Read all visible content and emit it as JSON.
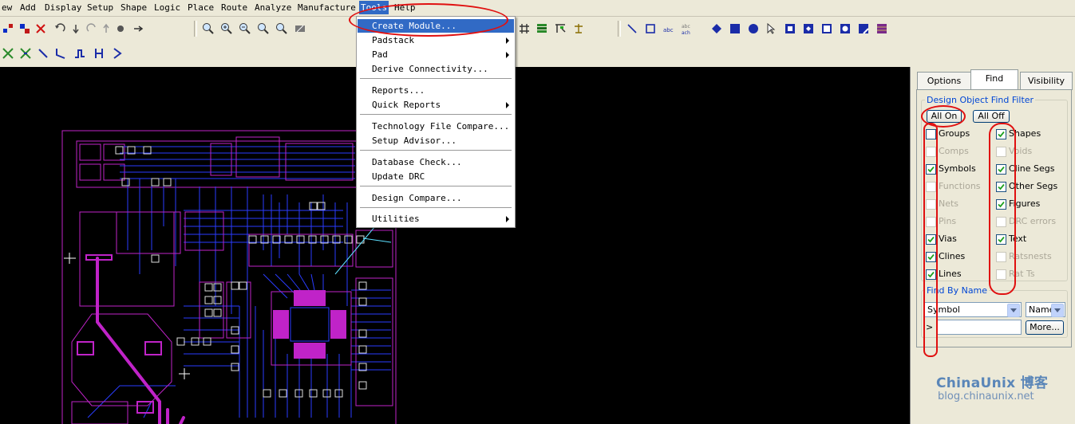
{
  "menubar": {
    "items": [
      "ew",
      "Add",
      "Display",
      "Setup",
      "Shape",
      "Logic",
      "Place",
      "Route",
      "Analyze",
      "Manufacture",
      "Tools",
      "Help"
    ],
    "active": "Tools"
  },
  "tools_menu": {
    "items": [
      {
        "label": "Create Module...",
        "submenu": false
      },
      {
        "label": "Padstack",
        "submenu": true
      },
      {
        "label": "Pad",
        "submenu": true
      },
      {
        "label": "Derive Connectivity...",
        "submenu": false
      },
      {
        "label": "Reports...",
        "submenu": false
      },
      {
        "label": "Quick Reports",
        "submenu": true
      },
      {
        "label": "Technology File Compare...",
        "submenu": false
      },
      {
        "label": "Setup Advisor...",
        "submenu": false
      },
      {
        "label": "Database Check...",
        "submenu": false
      },
      {
        "label": "Update DRC",
        "submenu": false
      },
      {
        "label": "Design Compare...",
        "submenu": false
      },
      {
        "label": "Utilities",
        "submenu": true
      }
    ],
    "highlighted": "Create Module..."
  },
  "panel": {
    "tabs": [
      "Options",
      "Find",
      "Visibility"
    ],
    "active_tab": "Find",
    "find_filter": {
      "title": "Design Object Find Filter",
      "all_on_label": "All On",
      "all_off_label": "All Off",
      "left_column": [
        {
          "label": "Groups",
          "checked": false,
          "enabled": true
        },
        {
          "label": "Comps",
          "checked": false,
          "enabled": false
        },
        {
          "label": "Symbols",
          "checked": true,
          "enabled": true
        },
        {
          "label": "Functions",
          "checked": false,
          "enabled": false
        },
        {
          "label": "Nets",
          "checked": false,
          "enabled": false
        },
        {
          "label": "Pins",
          "checked": false,
          "enabled": false
        },
        {
          "label": "Vias",
          "checked": true,
          "enabled": true
        },
        {
          "label": "Clines",
          "checked": true,
          "enabled": true
        },
        {
          "label": "Lines",
          "checked": true,
          "enabled": true
        }
      ],
      "right_column": [
        {
          "label": "Shapes",
          "checked": true,
          "enabled": true
        },
        {
          "label": "Voids",
          "checked": false,
          "enabled": false
        },
        {
          "label": "Cline Segs",
          "checked": true,
          "enabled": true
        },
        {
          "label": "Other Segs",
          "checked": true,
          "enabled": true
        },
        {
          "label": "Figures",
          "checked": true,
          "enabled": true
        },
        {
          "label": "DRC errors",
          "checked": false,
          "enabled": false
        },
        {
          "label": "Text",
          "checked": true,
          "enabled": true
        },
        {
          "label": "Ratsnests",
          "checked": false,
          "enabled": false
        },
        {
          "label": "Rat Ts",
          "checked": false,
          "enabled": false
        }
      ]
    },
    "find_by_name": {
      "title": "Find By Name",
      "type_value": "Symbol",
      "mode_value": "Name",
      "prompt_glyph": ">",
      "input_value": "",
      "more_label": "More..."
    }
  },
  "watermark": {
    "line1": "ChinaUnix 博客",
    "line2": "blog.chinaunix.net"
  },
  "colors": {
    "canvas": "#000000",
    "trace_blue": "#2a3cff",
    "trace_magenta": "#c023c8",
    "highlight": "#316ac5",
    "annotation_red": "#e01010"
  }
}
